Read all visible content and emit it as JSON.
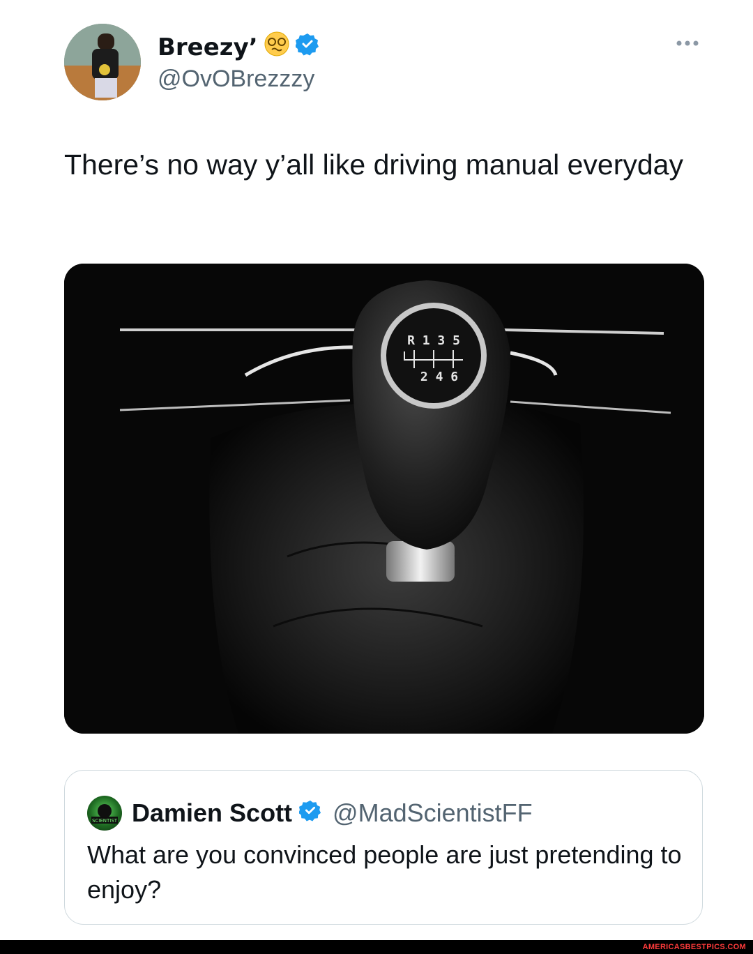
{
  "tweet": {
    "display_name": "Breezy’",
    "handle": "@OvOBrezzzy",
    "text": "There’s no way y’all like driving manual everyday",
    "more_icon": "more-horizontal-icon",
    "verified_icon": "verified-badge-icon",
    "emoji_icon": "dizzy-face-emoji-icon",
    "media": {
      "shift_pattern_top": "R 1 3 5",
      "shift_pattern_bottom": "2 4 6"
    }
  },
  "quote": {
    "display_name": "Damien Scott",
    "handle": "@MadScientistFF",
    "text": "What are you convinced people are just pretending to enjoy?",
    "avatar_label": "SCIENTIST"
  },
  "footer": {
    "watermark": "AMERICASBESTPICS.COM"
  },
  "colors": {
    "verified": "#1d9bf0",
    "secondary_text": "#536471",
    "border": "#cfd9de",
    "watermark": "#ff3b3b"
  }
}
